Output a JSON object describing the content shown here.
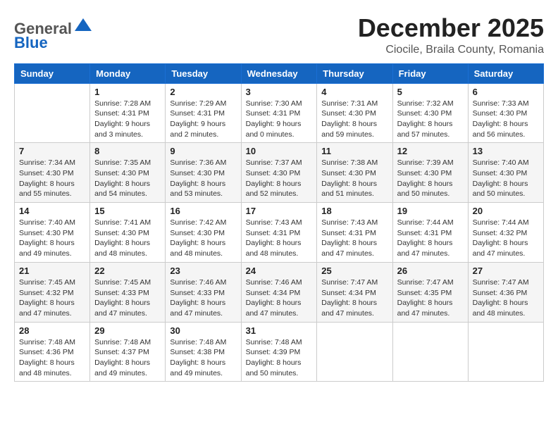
{
  "header": {
    "logo_general": "General",
    "logo_blue": "Blue",
    "month_title": "December 2025",
    "location": "Ciocile, Braila County, Romania"
  },
  "weekdays": [
    "Sunday",
    "Monday",
    "Tuesday",
    "Wednesday",
    "Thursday",
    "Friday",
    "Saturday"
  ],
  "weeks": [
    [
      {
        "day": "",
        "sunrise": "",
        "sunset": "",
        "daylight": ""
      },
      {
        "day": "1",
        "sunrise": "Sunrise: 7:28 AM",
        "sunset": "Sunset: 4:31 PM",
        "daylight": "Daylight: 9 hours and 3 minutes."
      },
      {
        "day": "2",
        "sunrise": "Sunrise: 7:29 AM",
        "sunset": "Sunset: 4:31 PM",
        "daylight": "Daylight: 9 hours and 2 minutes."
      },
      {
        "day": "3",
        "sunrise": "Sunrise: 7:30 AM",
        "sunset": "Sunset: 4:31 PM",
        "daylight": "Daylight: 9 hours and 0 minutes."
      },
      {
        "day": "4",
        "sunrise": "Sunrise: 7:31 AM",
        "sunset": "Sunset: 4:30 PM",
        "daylight": "Daylight: 8 hours and 59 minutes."
      },
      {
        "day": "5",
        "sunrise": "Sunrise: 7:32 AM",
        "sunset": "Sunset: 4:30 PM",
        "daylight": "Daylight: 8 hours and 57 minutes."
      },
      {
        "day": "6",
        "sunrise": "Sunrise: 7:33 AM",
        "sunset": "Sunset: 4:30 PM",
        "daylight": "Daylight: 8 hours and 56 minutes."
      }
    ],
    [
      {
        "day": "7",
        "sunrise": "Sunrise: 7:34 AM",
        "sunset": "Sunset: 4:30 PM",
        "daylight": "Daylight: 8 hours and 55 minutes."
      },
      {
        "day": "8",
        "sunrise": "Sunrise: 7:35 AM",
        "sunset": "Sunset: 4:30 PM",
        "daylight": "Daylight: 8 hours and 54 minutes."
      },
      {
        "day": "9",
        "sunrise": "Sunrise: 7:36 AM",
        "sunset": "Sunset: 4:30 PM",
        "daylight": "Daylight: 8 hours and 53 minutes."
      },
      {
        "day": "10",
        "sunrise": "Sunrise: 7:37 AM",
        "sunset": "Sunset: 4:30 PM",
        "daylight": "Daylight: 8 hours and 52 minutes."
      },
      {
        "day": "11",
        "sunrise": "Sunrise: 7:38 AM",
        "sunset": "Sunset: 4:30 PM",
        "daylight": "Daylight: 8 hours and 51 minutes."
      },
      {
        "day": "12",
        "sunrise": "Sunrise: 7:39 AM",
        "sunset": "Sunset: 4:30 PM",
        "daylight": "Daylight: 8 hours and 50 minutes."
      },
      {
        "day": "13",
        "sunrise": "Sunrise: 7:40 AM",
        "sunset": "Sunset: 4:30 PM",
        "daylight": "Daylight: 8 hours and 50 minutes."
      }
    ],
    [
      {
        "day": "14",
        "sunrise": "Sunrise: 7:40 AM",
        "sunset": "Sunset: 4:30 PM",
        "daylight": "Daylight: 8 hours and 49 minutes."
      },
      {
        "day": "15",
        "sunrise": "Sunrise: 7:41 AM",
        "sunset": "Sunset: 4:30 PM",
        "daylight": "Daylight: 8 hours and 48 minutes."
      },
      {
        "day": "16",
        "sunrise": "Sunrise: 7:42 AM",
        "sunset": "Sunset: 4:30 PM",
        "daylight": "Daylight: 8 hours and 48 minutes."
      },
      {
        "day": "17",
        "sunrise": "Sunrise: 7:43 AM",
        "sunset": "Sunset: 4:31 PM",
        "daylight": "Daylight: 8 hours and 48 minutes."
      },
      {
        "day": "18",
        "sunrise": "Sunrise: 7:43 AM",
        "sunset": "Sunset: 4:31 PM",
        "daylight": "Daylight: 8 hours and 47 minutes."
      },
      {
        "day": "19",
        "sunrise": "Sunrise: 7:44 AM",
        "sunset": "Sunset: 4:31 PM",
        "daylight": "Daylight: 8 hours and 47 minutes."
      },
      {
        "day": "20",
        "sunrise": "Sunrise: 7:44 AM",
        "sunset": "Sunset: 4:32 PM",
        "daylight": "Daylight: 8 hours and 47 minutes."
      }
    ],
    [
      {
        "day": "21",
        "sunrise": "Sunrise: 7:45 AM",
        "sunset": "Sunset: 4:32 PM",
        "daylight": "Daylight: 8 hours and 47 minutes."
      },
      {
        "day": "22",
        "sunrise": "Sunrise: 7:45 AM",
        "sunset": "Sunset: 4:33 PM",
        "daylight": "Daylight: 8 hours and 47 minutes."
      },
      {
        "day": "23",
        "sunrise": "Sunrise: 7:46 AM",
        "sunset": "Sunset: 4:33 PM",
        "daylight": "Daylight: 8 hours and 47 minutes."
      },
      {
        "day": "24",
        "sunrise": "Sunrise: 7:46 AM",
        "sunset": "Sunset: 4:34 PM",
        "daylight": "Daylight: 8 hours and 47 minutes."
      },
      {
        "day": "25",
        "sunrise": "Sunrise: 7:47 AM",
        "sunset": "Sunset: 4:34 PM",
        "daylight": "Daylight: 8 hours and 47 minutes."
      },
      {
        "day": "26",
        "sunrise": "Sunrise: 7:47 AM",
        "sunset": "Sunset: 4:35 PM",
        "daylight": "Daylight: 8 hours and 47 minutes."
      },
      {
        "day": "27",
        "sunrise": "Sunrise: 7:47 AM",
        "sunset": "Sunset: 4:36 PM",
        "daylight": "Daylight: 8 hours and 48 minutes."
      }
    ],
    [
      {
        "day": "28",
        "sunrise": "Sunrise: 7:48 AM",
        "sunset": "Sunset: 4:36 PM",
        "daylight": "Daylight: 8 hours and 48 minutes."
      },
      {
        "day": "29",
        "sunrise": "Sunrise: 7:48 AM",
        "sunset": "Sunset: 4:37 PM",
        "daylight": "Daylight: 8 hours and 49 minutes."
      },
      {
        "day": "30",
        "sunrise": "Sunrise: 7:48 AM",
        "sunset": "Sunset: 4:38 PM",
        "daylight": "Daylight: 8 hours and 49 minutes."
      },
      {
        "day": "31",
        "sunrise": "Sunrise: 7:48 AM",
        "sunset": "Sunset: 4:39 PM",
        "daylight": "Daylight: 8 hours and 50 minutes."
      },
      {
        "day": "",
        "sunrise": "",
        "sunset": "",
        "daylight": ""
      },
      {
        "day": "",
        "sunrise": "",
        "sunset": "",
        "daylight": ""
      },
      {
        "day": "",
        "sunrise": "",
        "sunset": "",
        "daylight": ""
      }
    ]
  ]
}
